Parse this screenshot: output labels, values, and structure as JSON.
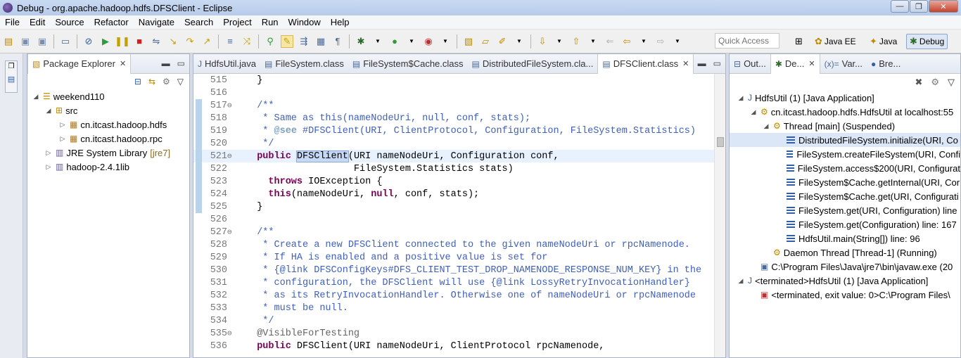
{
  "window": {
    "title": "Debug - org.apache.hadoop.hdfs.DFSClient - Eclipse"
  },
  "menu": [
    "File",
    "Edit",
    "Source",
    "Refactor",
    "Navigate",
    "Search",
    "Project",
    "Run",
    "Window",
    "Help"
  ],
  "toolbar": {
    "quick_access_placeholder": "Quick Access",
    "perspectives": {
      "java_ee": "Java EE",
      "java": "Java",
      "debug": "Debug"
    }
  },
  "package_explorer": {
    "tab_label": "Package Explorer",
    "tree": {
      "project": "weekend110",
      "src": "src",
      "pkg1": "cn.itcast.hadoop.hdfs",
      "pkg2": "cn.itcast.hadoop.rpc",
      "jre": "JRE System Library",
      "jre_deco": "[jre7]",
      "lib": "hadoop-2.4.1lib"
    }
  },
  "editor": {
    "tabs": {
      "t1": "HdfsUtil.java",
      "t2": "FileSystem.class",
      "t3": "FileSystem$Cache.class",
      "t4": "DistributedFileSystem.cla...",
      "t5": "DFSClient.class"
    },
    "lines": {
      "l515": {
        "n": "515",
        "text": "  }"
      },
      "l516": {
        "n": "516",
        "text": ""
      },
      "l517": {
        "n": "517",
        "text": "  /**"
      },
      "l518": {
        "n": "518",
        "text": "   * Same as this(nameNodeUri, null, conf, stats);"
      },
      "l519": {
        "n": "519",
        "a": "   * ",
        "b": "@see",
        "c": " #DFSClient(URI, ClientProtocol, Configuration, FileSystem.Statistics)"
      },
      "l520": {
        "n": "520",
        "text": "   */"
      },
      "l521": {
        "n": "521",
        "kw": "  public ",
        "sel": "DFSClient",
        "rest": "(URI nameNodeUri, Configuration conf,"
      },
      "l522": {
        "n": "522",
        "text": "                   FileSystem.Statistics stats)"
      },
      "l523": {
        "n": "523",
        "a": "    ",
        "kw": "throws",
        "rest": " IOException {"
      },
      "l524": {
        "n": "524",
        "a": "    ",
        "kw": "this",
        "b": "(nameNodeUri, ",
        "kw2": "null",
        "rest": ", conf, stats);"
      },
      "l525": {
        "n": "525",
        "text": "  }"
      },
      "l526": {
        "n": "526",
        "text": ""
      },
      "l527": {
        "n": "527",
        "text": "  /**"
      },
      "l528": {
        "n": "528",
        "text": "   * Create a new DFSClient connected to the given nameNodeUri or rpcNamenode."
      },
      "l529": {
        "n": "529",
        "text": "   * If HA is enabled and a positive value is set for"
      },
      "l530": {
        "n": "530",
        "text": "   * {@link DFSConfigKeys#DFS_CLIENT_TEST_DROP_NAMENODE_RESPONSE_NUM_KEY} in the"
      },
      "l531": {
        "n": "531",
        "text": "   * configuration, the DFSClient will use {@link LossyRetryInvocationHandler}"
      },
      "l532": {
        "n": "532",
        "text": "   * as its RetryInvocationHandler. Otherwise one of nameNodeUri or rpcNamenode"
      },
      "l533": {
        "n": "533",
        "text": "   * must be null."
      },
      "l534": {
        "n": "534",
        "text": "   */"
      },
      "l535": {
        "n": "535",
        "text": "  @VisibleForTesting"
      },
      "l536": {
        "n": "536",
        "kw": "  public ",
        "rest": "DFSClient(URI nameNodeUri, ClientProtocol rpcNamenode,"
      }
    }
  },
  "debug_view": {
    "tabs": {
      "outline": "Out...",
      "debug": "De...",
      "variables": "Var...",
      "breakpoints": "Bre..."
    },
    "tree": {
      "r1": "HdfsUtil (1) [Java Application]",
      "r2": "cn.itcast.hadoop.hdfs.HdfsUtil at localhost:55",
      "r3": "Thread [main] (Suspended)",
      "r4": "DistributedFileSystem.initialize(URI, Co",
      "r5": "FileSystem.createFileSystem(URI, Confi",
      "r6": "FileSystem.access$200(URI, Configurat",
      "r7": "FileSystem$Cache.getInternal(URI, Cor",
      "r8": "FileSystem$Cache.get(URI, Configurati",
      "r9": "FileSystem.get(URI, Configuration) line",
      "r10": "FileSystem.get(Configuration) line: 167",
      "r11": "HdfsUtil.main(String[]) line: 96",
      "r12": "Daemon Thread [Thread-1] (Running)",
      "r13": "C:\\Program Files\\Java\\jre7\\bin\\javaw.exe (20",
      "r14": "<terminated>HdfsUtil (1) [Java Application]",
      "r15": "<terminated, exit value: 0>C:\\Program Files\\"
    }
  }
}
